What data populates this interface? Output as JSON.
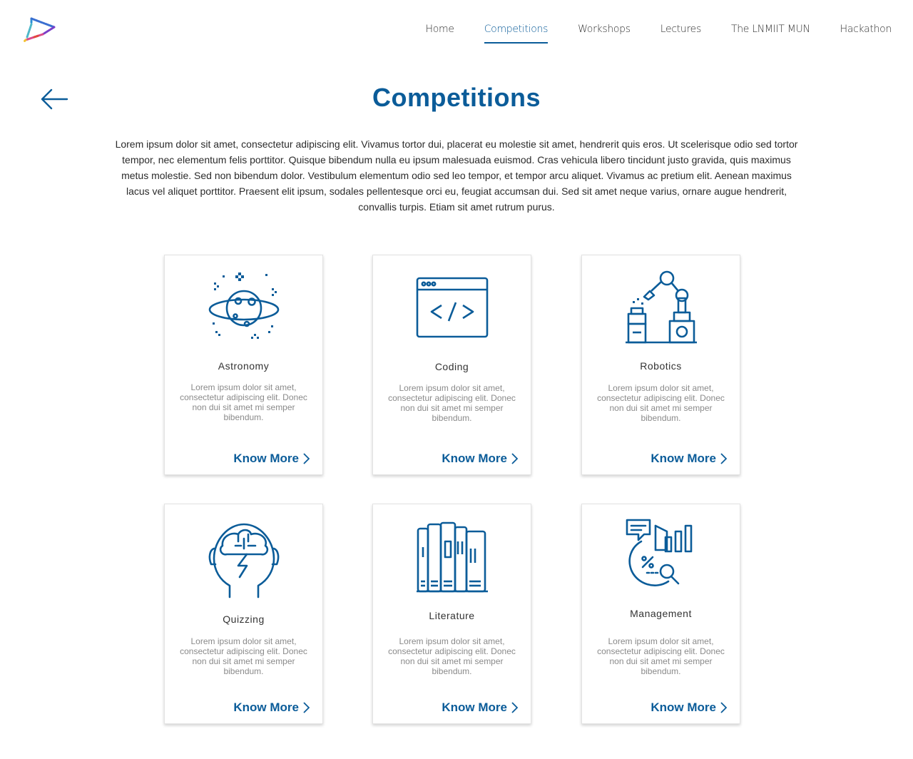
{
  "nav": {
    "items": [
      {
        "label": "Home"
      },
      {
        "label": "Competitions"
      },
      {
        "label": "Workshops"
      },
      {
        "label": "Lectures"
      },
      {
        "label": "The LNMIIT MUN"
      },
      {
        "label": "Hackathon"
      }
    ],
    "active_index": 1
  },
  "page": {
    "title": "Competitions",
    "intro": "Lorem ipsum dolor sit amet, consectetur adipiscing elit. Vivamus tortor dui, placerat eu molestie sit amet, hendrerit quis eros. Ut scelerisque odio sed tortor tempor, nec elementum felis porttitor. Quisque bibendum nulla eu ipsum malesuada euismod. Cras vehicula libero tincidunt justo gravida, quis maximus metus molestie. Sed non bibendum dolor. Vestibulum elementum odio sed leo tempor, et tempor arcu aliquet. Vivamus ac pretium elit. Aenean maximus lacus vel aliquet porttitor. Praesent elit ipsum, sodales pellentesque orci eu, feugiat accumsan dui. Sed sit amet neque varius, ornare augue hendrerit, convallis turpis. Etiam sit amet rutrum purus."
  },
  "cards": [
    {
      "name": "Astronomy",
      "icon": "planet-icon",
      "desc": "Lorem ipsum dolor sit amet, consectetur adipiscing elit. Donec non dui sit amet mi semper bibendum.",
      "more": "Know More"
    },
    {
      "name": "Coding",
      "icon": "code-window-icon",
      "desc": "Lorem ipsum dolor sit amet, consectetur adipiscing elit. Donec non dui sit amet mi semper bibendum.",
      "more": "Know More"
    },
    {
      "name": "Robotics",
      "icon": "robot-arm-icon",
      "desc": "Lorem ipsum dolor sit amet, consectetur adipiscing elit. Donec non dui sit amet mi semper bibendum.",
      "more": "Know More"
    },
    {
      "name": "Quizzing",
      "icon": "brain-head-icon",
      "desc": "Lorem ipsum dolor sit amet, consectetur adipiscing elit. Donec non dui sit amet mi semper bibendum.",
      "more": "Know More"
    },
    {
      "name": "Literature",
      "icon": "books-icon",
      "desc": "Lorem ipsum dolor sit amet, consectetur adipiscing elit. Donec non dui sit amet mi semper bibendum.",
      "more": "Know More"
    },
    {
      "name": "Management",
      "icon": "analytics-icon",
      "desc": "Lorem ipsum dolor sit amet, consectetur adipiscing elit. Donec non dui sit amet mi semper bibendum.",
      "more": "Know More"
    }
  ],
  "colors": {
    "accent": "#0b5c99",
    "text": "#222222",
    "muted": "#8a8a8a"
  }
}
